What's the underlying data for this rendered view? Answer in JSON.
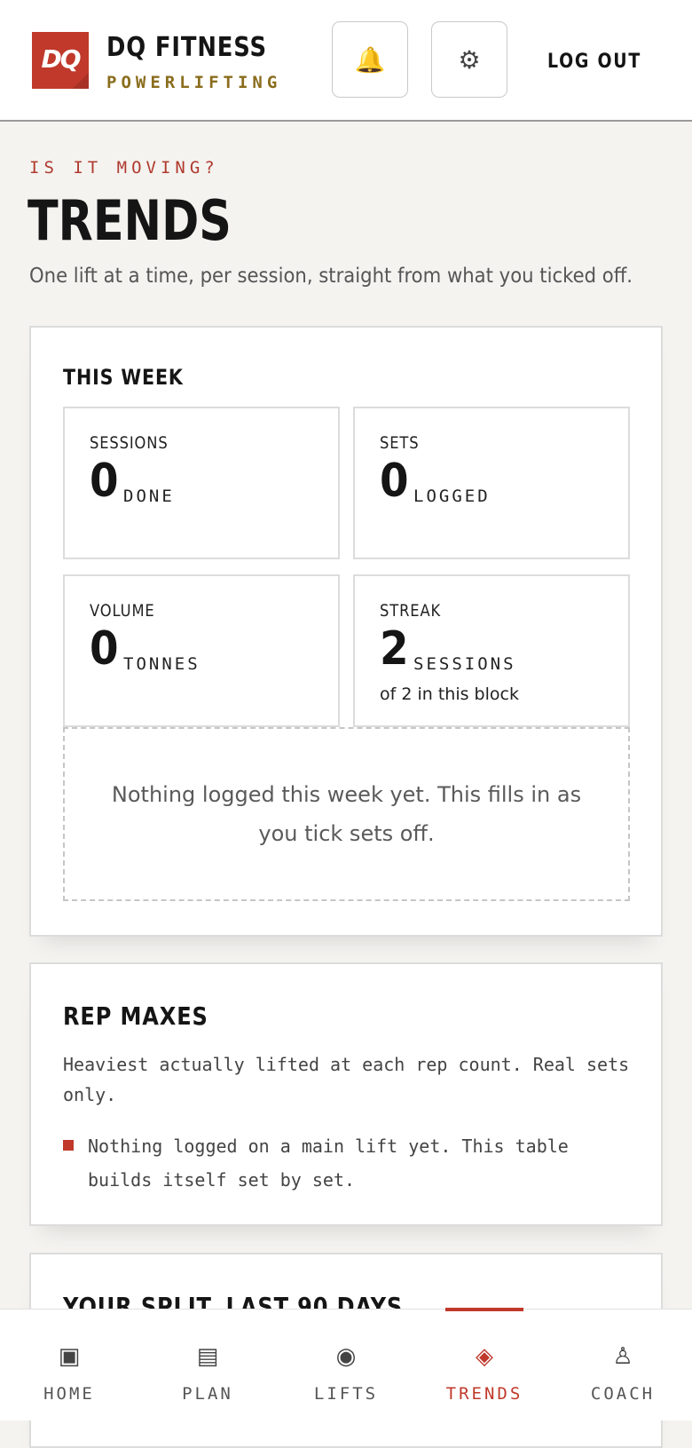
{
  "header": {
    "logo_text": "DQ",
    "brand_name": "DQ FITNESS",
    "brand_sub": "POWERLIFTING",
    "logout_label": "LOG OUT"
  },
  "icons": {
    "notifications": "bell-icon",
    "settings": "gear-icon"
  },
  "page": {
    "eyebrow": "IS IT MOVING?",
    "title": "TRENDS",
    "description": "One lift at a time, per session, straight from what you ticked off."
  },
  "this_week": {
    "title": "THIS WEEK",
    "stats": [
      {
        "label": "SESSIONS",
        "value": "0",
        "unit": "DONE"
      },
      {
        "label": "SETS",
        "value": "0",
        "unit": "LOGGED"
      },
      {
        "label": "VOLUME",
        "value": "0",
        "unit": "TONNES"
      },
      {
        "label": "STREAK",
        "value": "2",
        "unit": "SESSIONS",
        "note": "of 2 in this block"
      }
    ],
    "empty_message": "Nothing logged this week yet. This fills in as you tick sets off."
  },
  "rep_maxes": {
    "title": "REP MAXES",
    "description": "Heaviest actually lifted at each rep count. Real sets only.",
    "empty_message": "Nothing logged on a main lift yet. This table builds itself set by set."
  },
  "split": {
    "title": "YOUR SPLIT, LAST 90 DAYS"
  },
  "nav": {
    "items": [
      {
        "label": "HOME",
        "icon": "▣"
      },
      {
        "label": "PLAN",
        "icon": "▤"
      },
      {
        "label": "LIFTS",
        "icon": "◉"
      },
      {
        "label": "TRENDS",
        "icon": "◈"
      },
      {
        "label": "COACH",
        "icon": "♙"
      }
    ],
    "active": "TRENDS"
  },
  "colors": {
    "accent": "#c0392b",
    "brand_gold": "#8a6d1d",
    "background": "#f4f3f0"
  }
}
